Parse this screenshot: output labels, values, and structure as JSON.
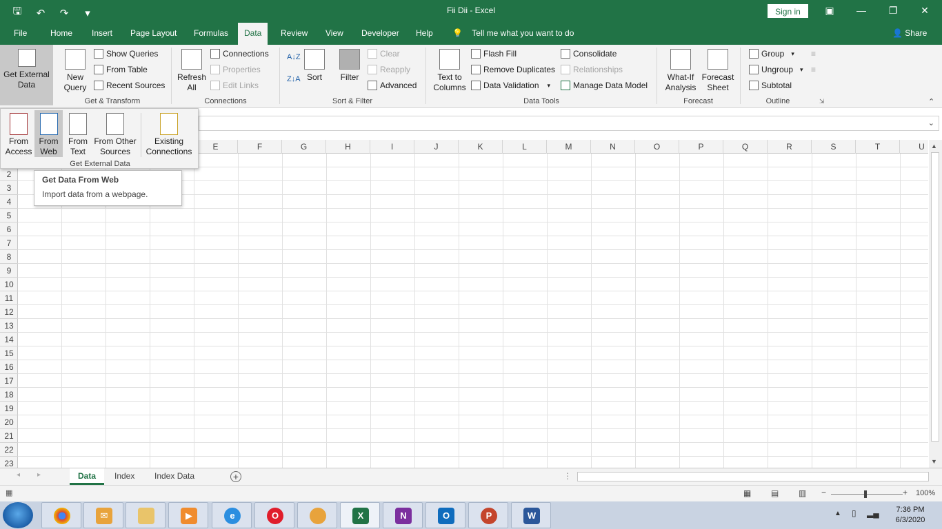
{
  "window": {
    "title": "Fii Dii  -  Excel",
    "signin": "Sign in"
  },
  "menu": {
    "tabs": [
      "File",
      "Home",
      "Insert",
      "Page Layout",
      "Formulas",
      "Data",
      "Review",
      "View",
      "Developer",
      "Help"
    ],
    "active": "Data",
    "tellme": "Tell me what you want to do",
    "share": "Share"
  },
  "ribbon": {
    "get_external_data": "Get External Data",
    "new_query": "New Query",
    "show_queries": "Show Queries",
    "from_table": "From Table",
    "recent_sources": "Recent Sources",
    "get_transform": "Get & Transform",
    "refresh_all": "Refresh All",
    "connections_btn": "Connections",
    "properties": "Properties",
    "edit_links": "Edit Links",
    "connections_group": "Connections",
    "sort": "Sort",
    "filter": "Filter",
    "clear": "Clear",
    "reapply": "Reapply",
    "advanced": "Advanced",
    "sort_filter": "Sort & Filter",
    "text_to_columns": "Text to Columns",
    "flash_fill": "Flash Fill",
    "remove_duplicates": "Remove Duplicates",
    "data_validation": "Data Validation",
    "consolidate": "Consolidate",
    "relationships": "Relationships",
    "manage_data_model": "Manage Data Model",
    "data_tools": "Data Tools",
    "what_if": "What-If Analysis",
    "forecast_sheet": "Forecast Sheet",
    "forecast": "Forecast",
    "group": "Group",
    "ungroup": "Ungroup",
    "subtotal": "Subtotal",
    "outline": "Outline"
  },
  "dropdown": {
    "from_access": "From Access",
    "from_web": "From Web",
    "from_text": "From Text",
    "from_other": "From Other Sources",
    "existing": "Existing Connections",
    "label": "Get External Data"
  },
  "tooltip": {
    "title": "Get Data From Web",
    "desc": "Import data from a webpage."
  },
  "grid": {
    "columns": [
      "E",
      "F",
      "G",
      "H",
      "I",
      "J",
      "K",
      "L",
      "M",
      "N",
      "O",
      "P",
      "Q",
      "R",
      "S",
      "T",
      "U"
    ],
    "rows": [
      "2",
      "3",
      "4",
      "5",
      "6",
      "7",
      "8",
      "9",
      "10",
      "11",
      "12",
      "13",
      "14",
      "15",
      "16",
      "17",
      "18",
      "19",
      "20",
      "21",
      "22",
      "23"
    ]
  },
  "sheets": {
    "tabs": [
      "Data",
      "Index",
      "Index Data"
    ],
    "active": "Data"
  },
  "status": {
    "zoom": "100%"
  },
  "taskbar": {
    "time": "7:36 PM",
    "date": "6/3/2020"
  }
}
